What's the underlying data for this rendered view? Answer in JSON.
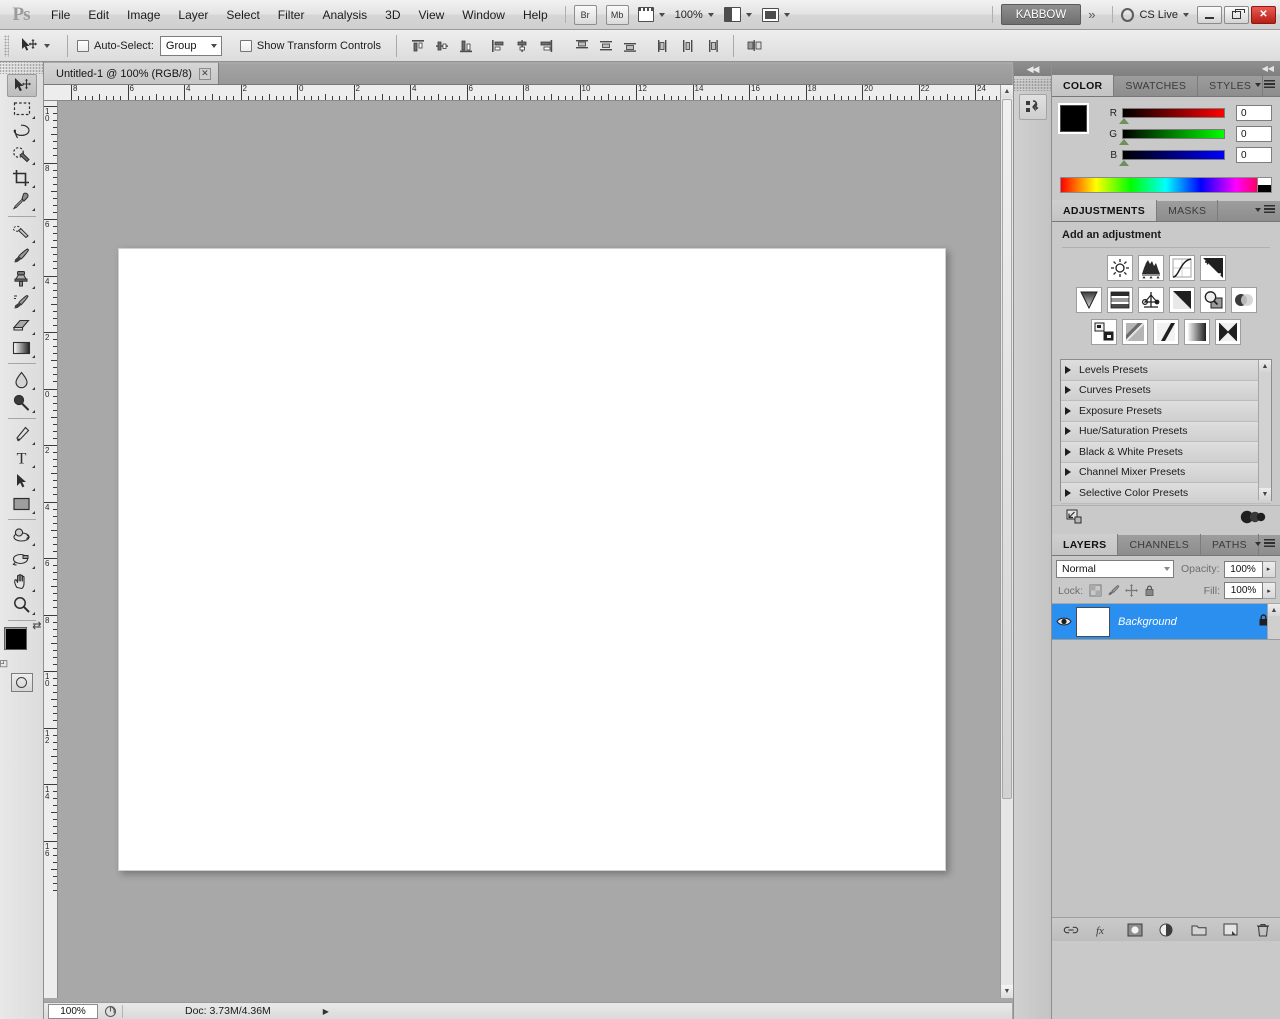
{
  "app": {
    "logo": "Ps",
    "menus": [
      "File",
      "Edit",
      "Image",
      "Layer",
      "Select",
      "Filter",
      "Analysis",
      "3D",
      "View",
      "Window",
      "Help"
    ],
    "bridge_button": "Br",
    "minibridge_button": "Mb",
    "zoom_level": "100%",
    "workspace": "KABBOW",
    "chevron": "»",
    "cs_live": "CS Live",
    "window_buttons": {
      "minimize": "─",
      "restore": "❐",
      "close": "✕"
    }
  },
  "options_bar": {
    "auto_select_label": "Auto-Select:",
    "auto_select_value": "Group",
    "show_transform_label": "Show Transform Controls",
    "align_buttons": [
      "align-top-edges",
      "align-vertical-centers",
      "align-bottom-edges",
      "align-left-edges",
      "align-horizontal-centers",
      "align-right-edges",
      "distribute-top-edges",
      "distribute-vertical-centers",
      "distribute-bottom-edges",
      "distribute-left-edges",
      "distribute-horizontal-centers",
      "distribute-right-edges",
      "auto-align-layers"
    ]
  },
  "document": {
    "tab_title": "Untitled-1 @ 100% (RGB/8)",
    "close_glyph": "✕"
  },
  "rulers": {
    "horizontal_ticks": [
      "8",
      "6",
      "4",
      "2",
      "0",
      "2",
      "4",
      "6",
      "8",
      "10",
      "12",
      "14",
      "16",
      "18",
      "20",
      "22",
      "24"
    ],
    "vertical_ticks": [
      "10",
      "8",
      "6",
      "4",
      "2",
      "0",
      "2",
      "4",
      "6",
      "8",
      "10",
      "12",
      "14",
      "16"
    ]
  },
  "toolbox": {
    "tools": [
      {
        "name": "move-tool",
        "active": true,
        "more": false
      },
      {
        "name": "rectangular-marquee-tool",
        "active": false,
        "more": true
      },
      {
        "name": "lasso-tool",
        "active": false,
        "more": true
      },
      {
        "name": "quick-selection-tool",
        "active": false,
        "more": true
      },
      {
        "name": "crop-tool",
        "active": false,
        "more": true
      },
      {
        "name": "eyedropper-tool",
        "active": false,
        "more": true
      },
      {
        "name": "spot-healing-brush-tool",
        "active": false,
        "more": true
      },
      {
        "name": "brush-tool",
        "active": false,
        "more": true
      },
      {
        "name": "clone-stamp-tool",
        "active": false,
        "more": true
      },
      {
        "name": "history-brush-tool",
        "active": false,
        "more": true
      },
      {
        "name": "eraser-tool",
        "active": false,
        "more": true
      },
      {
        "name": "gradient-tool",
        "active": false,
        "more": true
      },
      {
        "name": "blur-tool",
        "active": false,
        "more": true
      },
      {
        "name": "dodge-tool",
        "active": false,
        "more": true
      },
      {
        "name": "pen-tool",
        "active": false,
        "more": true
      },
      {
        "name": "horizontal-type-tool",
        "active": false,
        "more": true
      },
      {
        "name": "path-selection-tool",
        "active": false,
        "more": true
      },
      {
        "name": "rectangle-shape-tool",
        "active": false,
        "more": true
      },
      {
        "name": "3d-object-rotate-tool",
        "active": false,
        "more": true
      },
      {
        "name": "3d-camera-orbit-tool",
        "active": false,
        "more": true
      },
      {
        "name": "hand-tool",
        "active": false,
        "more": true
      },
      {
        "name": "zoom-tool",
        "active": false,
        "more": true
      }
    ],
    "foreground_color": "#000000",
    "background_color": "#ffffff",
    "swap_glyph": "⇄",
    "default_glyph": "◰"
  },
  "status_bar": {
    "zoom": "100%",
    "doc_info": "Doc: 3.73M/4.36M",
    "triangle": "▶",
    "left_arrow": "◀"
  },
  "color_panel": {
    "tabs": [
      {
        "label": "COLOR",
        "active": true
      },
      {
        "label": "SWATCHES",
        "active": false
      },
      {
        "label": "STYLES",
        "active": false
      }
    ],
    "channels": [
      {
        "label": "R",
        "value": "0",
        "ramp_from": "#000000",
        "ramp_to": "#ff0000"
      },
      {
        "label": "G",
        "value": "0",
        "ramp_from": "#000000",
        "ramp_to": "#00ff00"
      },
      {
        "label": "B",
        "value": "0",
        "ramp_from": "#000000",
        "ramp_to": "#0000ff"
      }
    ]
  },
  "adjustments_panel": {
    "tabs": [
      {
        "label": "ADJUSTMENTS",
        "active": true
      },
      {
        "label": "MASKS",
        "active": false
      }
    ],
    "title": "Add an adjustment",
    "icons_row1": [
      "brightness-contrast-icon",
      "levels-icon",
      "curves-icon",
      "exposure-icon"
    ],
    "icons_row2": [
      "vibrance-icon",
      "hue-saturation-icon",
      "color-balance-icon",
      "black-white-icon",
      "photo-filter-icon",
      "channel-mixer-icon"
    ],
    "icons_row3": [
      "invert-icon",
      "posterize-icon",
      "threshold-icon",
      "gradient-map-icon",
      "selective-color-icon"
    ],
    "presets": [
      "Levels Presets",
      "Curves Presets",
      "Exposure Presets",
      "Hue/Saturation Presets",
      "Black & White Presets",
      "Channel Mixer Presets",
      "Selective Color Presets"
    ],
    "footer_left_icon": "return-to-adjustment-list-icon",
    "footer_right_icon": "clip-to-layer-icon"
  },
  "layers_panel": {
    "tabs": [
      {
        "label": "LAYERS",
        "active": true
      },
      {
        "label": "CHANNELS",
        "active": false
      },
      {
        "label": "PATHS",
        "active": false
      }
    ],
    "blend_mode": "Normal",
    "opacity_label": "Opacity:",
    "opacity_value": "100%",
    "lock_label": "Lock:",
    "fill_label": "Fill:",
    "fill_value": "100%",
    "lock_icons": [
      "lock-transparent-pixels-icon",
      "lock-image-pixels-icon",
      "lock-position-icon",
      "lock-all-icon"
    ],
    "layers": [
      {
        "name": "Background",
        "selected": true,
        "visible": true,
        "locked": true,
        "italic": true
      }
    ],
    "footer_buttons": [
      "link-layers-icon",
      "add-layer-style-icon",
      "add-layer-mask-icon",
      "new-adjustment-layer-icon",
      "new-group-icon",
      "new-layer-icon",
      "delete-layer-icon"
    ]
  },
  "dock_collapse": {
    "collapse_glyph": "◀◀",
    "button_icon": "history-actions-icon"
  }
}
